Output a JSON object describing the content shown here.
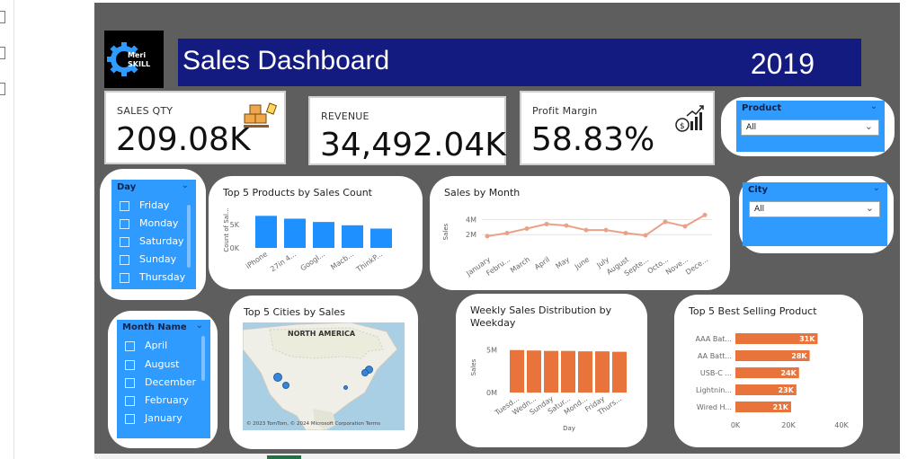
{
  "dashboard": {
    "title": "Sales Dashboard",
    "year": "2019",
    "logo_text_1": "Meri",
    "logo_text_2": "SKILL"
  },
  "kpis": [
    {
      "label": "SALES QTY",
      "value": "209.08K",
      "icon": "boxes-icon"
    },
    {
      "label": "REVENUE",
      "value": "34,492.04K"
    },
    {
      "label": "Profit Margin",
      "value": "58.83%",
      "icon": "money-growth-icon"
    }
  ],
  "slicers": {
    "product": {
      "title": "Product",
      "value": "All"
    },
    "city": {
      "title": "City",
      "value": "All"
    },
    "day": {
      "title": "Day",
      "items": [
        "Friday",
        "Monday",
        "Saturday",
        "Sunday",
        "Thursday"
      ]
    },
    "month": {
      "title": "Month Name",
      "items": [
        "April",
        "August",
        "December",
        "February",
        "January"
      ]
    }
  },
  "colors": {
    "canvas": "#5e5e5e",
    "banner": "#131a80",
    "blue_bar": "#1e90ff",
    "orange": "#e8743b",
    "line": "#eba187",
    "slicer": "#2f9bff"
  },
  "chart_data": [
    {
      "type": "bar",
      "title": "Top 5 Products by Sales Count",
      "ylabel": "Count of Sal...",
      "categories": [
        "iPhone",
        "27in 4...",
        "Googl...",
        "Macb...",
        "ThinkP..."
      ],
      "values": [
        6800,
        6200,
        5500,
        4800,
        4100
      ],
      "yticks": [
        "5K",
        "0K"
      ],
      "ylim": [
        0,
        8000
      ]
    },
    {
      "type": "line",
      "title": "Sales by Month",
      "ylabel": "Sales",
      "categories": [
        "January",
        "Febru...",
        "March",
        "April",
        "May",
        "June",
        "July",
        "August",
        "Septe...",
        "Octo...",
        "Nove...",
        "Dece..."
      ],
      "values": [
        1.8,
        2.2,
        2.8,
        3.4,
        3.2,
        2.6,
        2.6,
        2.2,
        1.9,
        3.7,
        3.1,
        4.6
      ],
      "yticks": [
        "4M",
        "2M"
      ],
      "ylim": [
        0,
        5
      ]
    },
    {
      "type": "map",
      "title": "Top 5 Cities by Sales",
      "region_label": "NORTH AMERICA",
      "credit": "© 2023 TomTom, © 2024 Microsoft Corporation  Terms",
      "provider": "Microsoft Bing"
    },
    {
      "type": "bar",
      "title": "Weekly Sales Distribution by Weekday",
      "xlabel": "Day",
      "ylabel": "Sales",
      "categories": [
        "Tuesd...",
        "Wedn...",
        "Sunday",
        "Satur...",
        "Mond...",
        "Friday",
        "Thurs..."
      ],
      "values": [
        5.0,
        4.95,
        4.9,
        4.9,
        4.85,
        4.85,
        4.8
      ],
      "yticks": [
        "5M",
        "0M"
      ],
      "ylim": [
        0,
        5.5
      ]
    },
    {
      "type": "bar",
      "orientation": "horizontal",
      "title": "Top 5 Best Selling Product",
      "categories": [
        "AAA Bat...",
        "AA Batt...",
        "USB-C ...",
        "Lightnin...",
        "Wired H..."
      ],
      "values": [
        31,
        28,
        24,
        23,
        21
      ],
      "value_labels": [
        "31K",
        "28K",
        "24K",
        "23K",
        "21K"
      ],
      "xticks": [
        "0K",
        "20K",
        "40K"
      ],
      "xlim": [
        0,
        40
      ]
    }
  ]
}
